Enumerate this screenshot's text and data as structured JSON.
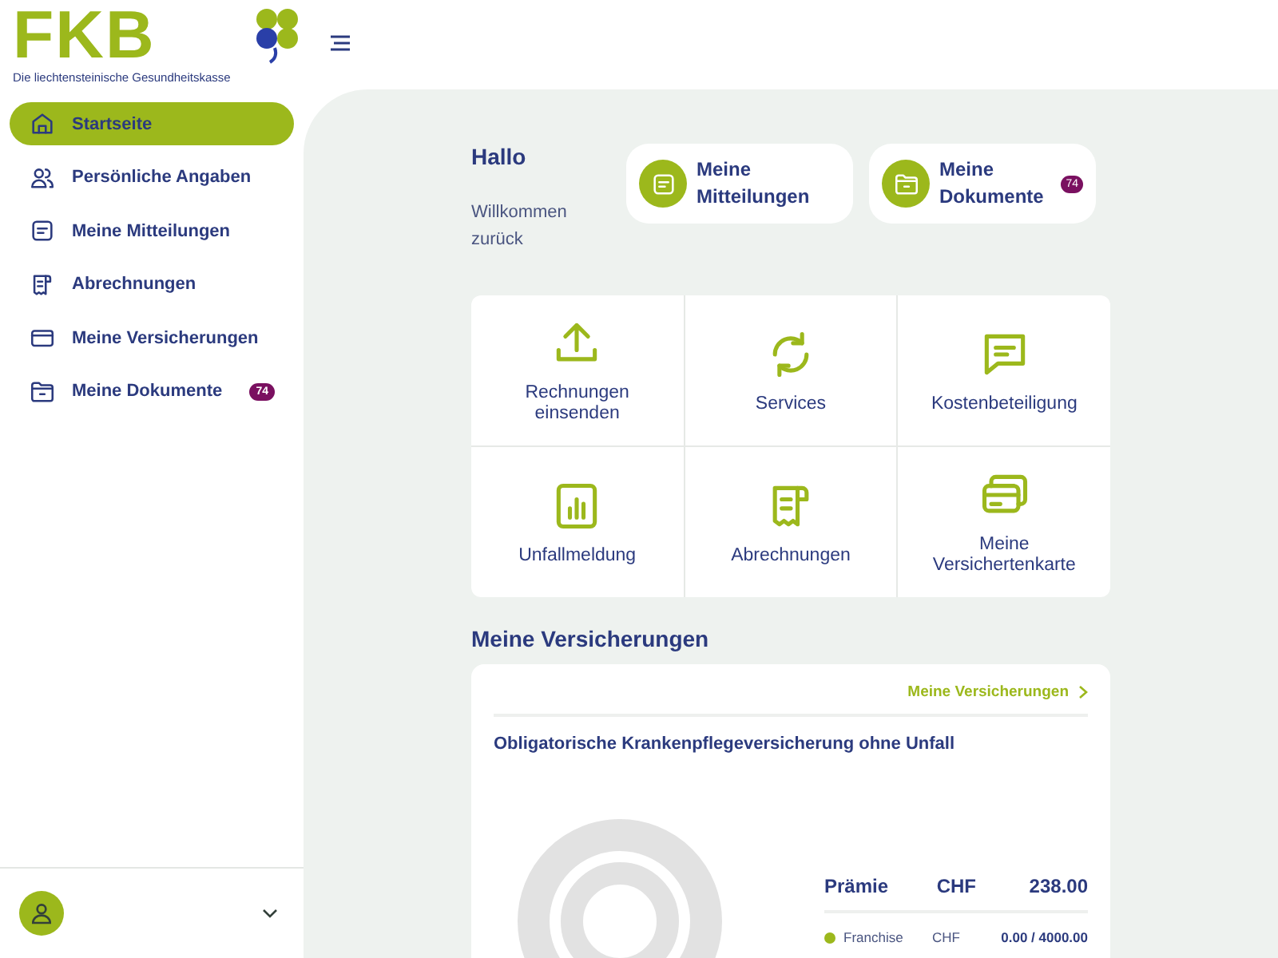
{
  "logo": {
    "wordmark": "FKB",
    "tagline": "Die liechtensteinische Gesundheitskasse"
  },
  "sidebar": {
    "items": [
      {
        "label": "Startseite",
        "selected": true
      },
      {
        "label": "Persönliche Angaben",
        "selected": false
      },
      {
        "label": "Meine Mitteilungen",
        "selected": false
      },
      {
        "label": "Abrechnungen",
        "selected": false
      },
      {
        "label": "Meine Versicherungen",
        "selected": false
      },
      {
        "label": "Meine Dokumente",
        "selected": false,
        "badge": "74"
      }
    ]
  },
  "greeting": {
    "title": "Hallo",
    "subtitle": "Willkommen zurück"
  },
  "quick_cards": [
    {
      "label": "Meine Mitteilungen"
    },
    {
      "label": "Meine Dokumente",
      "badge": "74"
    }
  ],
  "tiles": [
    {
      "label": "Rechnungen einsenden"
    },
    {
      "label": "Services"
    },
    {
      "label": "Kostenbeteiligung"
    },
    {
      "label": "Unfallmeldung"
    },
    {
      "label": "Abrechnungen"
    },
    {
      "label": "Meine Versichertenkarte"
    }
  ],
  "insurance": {
    "heading": "Meine Versicherungen",
    "link": "Meine Versicherungen",
    "title": "Obligatorische Krankenpflegeversicherung ohne Unfall",
    "premium": {
      "label": "Prämie",
      "currency": "CHF",
      "amount": "238.00"
    },
    "legend": [
      {
        "label": "Franchise",
        "currency": "CHF",
        "value": "0.00 / 4000.00",
        "color": "#9cb81c"
      }
    ]
  }
}
